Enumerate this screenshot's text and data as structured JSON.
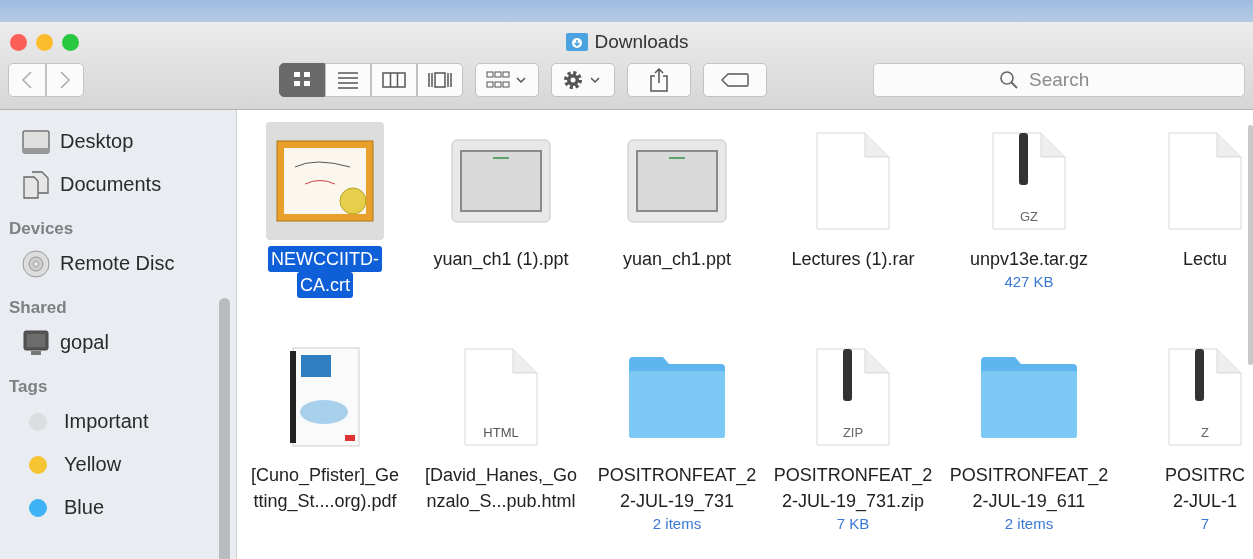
{
  "window": {
    "title": "Downloads"
  },
  "toolbar": {
    "views": [
      {
        "kind": "icons",
        "selected": true
      },
      {
        "kind": "list",
        "selected": false
      },
      {
        "kind": "columns",
        "selected": false
      },
      {
        "kind": "coverflow",
        "selected": false
      }
    ],
    "search": {
      "placeholder": "Search"
    }
  },
  "sidebar": {
    "sections": [
      {
        "items": [
          {
            "label": "Desktop",
            "kind": "desktop"
          },
          {
            "label": "Documents",
            "kind": "documents"
          }
        ]
      },
      {
        "header": "Devices",
        "items": [
          {
            "label": "Remote Disc",
            "kind": "disc"
          }
        ]
      },
      {
        "header": "Shared",
        "items": [
          {
            "label": "gopal",
            "kind": "computer"
          }
        ]
      },
      {
        "header": "Tags",
        "items": [
          {
            "label": "Important",
            "kind": "tag",
            "color": "#dcdde0"
          },
          {
            "label": "Yellow",
            "kind": "tag",
            "color": "#f5c533"
          },
          {
            "label": "Blue",
            "kind": "tag",
            "color": "#3fb1f5"
          }
        ]
      }
    ]
  },
  "files": [
    {
      "name_lines": [
        "NEWCCIITD-",
        "CA.crt"
      ],
      "kind": "certificate",
      "selected": true
    },
    {
      "name_lines": [
        "yuan_ch1 (1).ppt"
      ],
      "kind": "slide",
      "selected": false
    },
    {
      "name_lines": [
        "yuan_ch1.ppt"
      ],
      "kind": "slide",
      "selected": false
    },
    {
      "name_lines": [
        "Lectures (1).rar"
      ],
      "kind": "document",
      "selected": false
    },
    {
      "name_lines": [
        "unpv13e.tar.gz"
      ],
      "kind": "archive",
      "badge": "GZ",
      "info": "427 KB",
      "selected": false
    },
    {
      "name_lines": [
        "Lectu"
      ],
      "kind": "document",
      "selected": false
    },
    {
      "name_lines": [
        "[Cuno_Pfister]_Ge",
        "tting_St....org).pdf"
      ],
      "kind": "book",
      "selected": false
    },
    {
      "name_lines": [
        "[David_Hanes,_Go",
        "nzalo_S...pub.html"
      ],
      "kind": "document",
      "badge": "HTML",
      "selected": false
    },
    {
      "name_lines": [
        "POSITRONFEAT_2",
        "2-JUL-19_731"
      ],
      "kind": "folder",
      "info": "2 items",
      "selected": false
    },
    {
      "name_lines": [
        "POSITRONFEAT_2",
        "2-JUL-19_731.zip"
      ],
      "kind": "archive",
      "badge": "ZIP",
      "info": "7 KB",
      "selected": false
    },
    {
      "name_lines": [
        "POSITRONFEAT_2",
        "2-JUL-19_611"
      ],
      "kind": "folder",
      "info": "2 items",
      "selected": false
    },
    {
      "name_lines": [
        "POSITRC",
        "2-JUL-1"
      ],
      "kind": "archive",
      "badge": "Z",
      "info": "7",
      "selected": false
    }
  ]
}
